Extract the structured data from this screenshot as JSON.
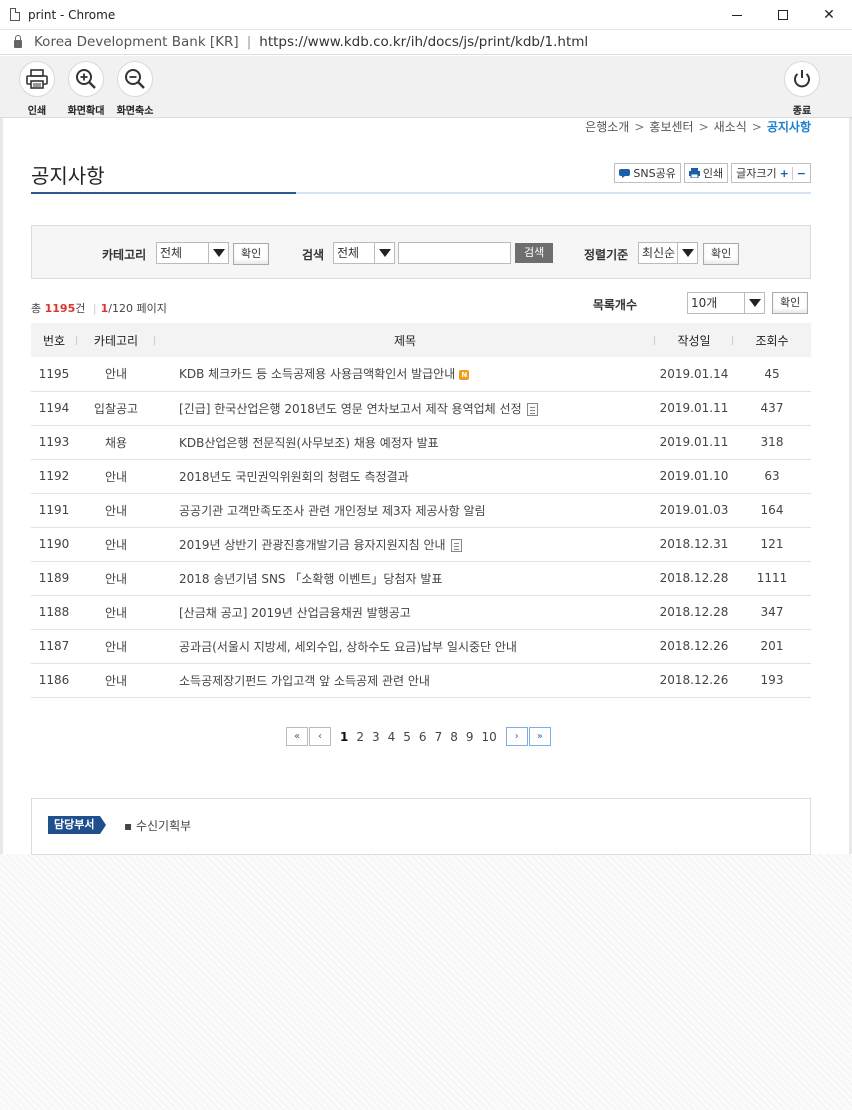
{
  "window": {
    "title": "print - Chrome",
    "site_name": "Korea Development Bank [KR]",
    "url": "https://www.kdb.co.kr/ih/docs/js/print/kdb/1.html"
  },
  "toolbar": {
    "print_label": "인쇄",
    "zoom_in_label": "화면확대",
    "zoom_out_label": "화면축소",
    "close_label": "종료"
  },
  "breadcrumb": {
    "items": [
      "은행소개",
      "홍보센터",
      "새소식"
    ],
    "current": "공지사항"
  },
  "page": {
    "title": "공지사항",
    "sns_label": "SNS공유",
    "print_label": "인쇄",
    "font_size_label": "글자크기"
  },
  "search": {
    "category_label": "카테고리",
    "category_value": "전체",
    "confirm_label": "확인",
    "search_label": "검색",
    "search_field_value": "전체",
    "search_input_value": "",
    "search_button": "검색",
    "sort_label": "정렬기준",
    "sort_value": "최신순"
  },
  "summary": {
    "prefix": "총",
    "total": "1195",
    "unit": "건",
    "current_page": "1",
    "total_pages": "/120 페이지",
    "list_count_label": "목록개수",
    "list_count_value": "10개",
    "confirm_label": "확인"
  },
  "table": {
    "headers": [
      "번호",
      "카테고리",
      "제목",
      "작성일",
      "조회수"
    ],
    "rows": [
      {
        "no": "1195",
        "category": "안내",
        "title": "KDB 체크카드 등 소득공제용 사용금액확인서 발급안내",
        "date": "2019.01.14",
        "views": "45",
        "icon": "new-icon"
      },
      {
        "no": "1194",
        "category": "입찰공고",
        "title": "[긴급] 한국산업은행 2018년도 영문 연차보고서 제작 용역업체 선정",
        "date": "2019.01.11",
        "views": "437",
        "icon": "file-icon"
      },
      {
        "no": "1193",
        "category": "채용",
        "title": "KDB산업은행 전문직원(사무보조) 채용 예정자 발표",
        "date": "2019.01.11",
        "views": "318",
        "icon": ""
      },
      {
        "no": "1192",
        "category": "안내",
        "title": "2018년도 국민권익위원회의 청렴도 측정결과",
        "date": "2019.01.10",
        "views": "63",
        "icon": ""
      },
      {
        "no": "1191",
        "category": "안내",
        "title": "공공기관 고객만족도조사 관련 개인정보 제3자 제공사항 알림",
        "date": "2019.01.03",
        "views": "164",
        "icon": ""
      },
      {
        "no": "1190",
        "category": "안내",
        "title": "2019년 상반기 관광진흥개발기금 융자지원지침 안내",
        "date": "2018.12.31",
        "views": "121",
        "icon": "file-icon"
      },
      {
        "no": "1189",
        "category": "안내",
        "title": "2018 송년기념 SNS 「소확행 이벤트」당첨자 발표",
        "date": "2018.12.28",
        "views": "1111",
        "icon": ""
      },
      {
        "no": "1188",
        "category": "안내",
        "title": "[산금채 공고] 2019년 산업금융채권 발행공고",
        "date": "2018.12.28",
        "views": "347",
        "icon": ""
      },
      {
        "no": "1187",
        "category": "안내",
        "title": "공과금(서울시 지방세, 세외수입, 상하수도 요금)납부 일시중단 안내",
        "date": "2018.12.26",
        "views": "201",
        "icon": ""
      },
      {
        "no": "1186",
        "category": "안내",
        "title": "소득공제장기펀드 가입고객 앞 소득공제 관련 안내",
        "date": "2018.12.26",
        "views": "193",
        "icon": ""
      }
    ]
  },
  "pagination": {
    "pages": [
      "1",
      "2",
      "3",
      "4",
      "5",
      "6",
      "7",
      "8",
      "9",
      "10"
    ],
    "active": "1"
  },
  "department": {
    "tag": "담당부서",
    "name": "수신기획부"
  },
  "colors": {
    "accent": "#1a7fd1",
    "title_underline": "#2a5a95",
    "count_red": "#dd3333",
    "dept_tag": "#1f4f8d"
  }
}
